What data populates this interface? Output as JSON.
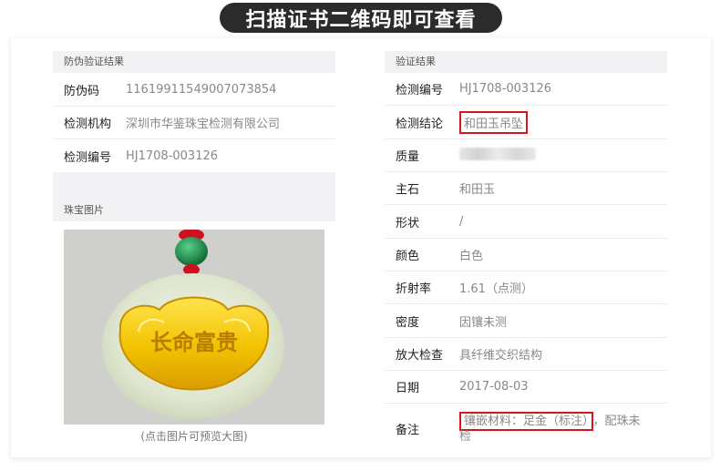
{
  "banner": {
    "title": "扫描证书二维码即可查看"
  },
  "left": {
    "section_title": "防伪验证结果",
    "rows": [
      {
        "label": "防伪码",
        "value": "11619911549007073854"
      },
      {
        "label": "检测机构",
        "value": "深圳市华鉴珠宝检测有限公司"
      },
      {
        "label": "检测编号",
        "value": "HJ1708-003126"
      }
    ],
    "image_section_title": "珠宝图片",
    "image_caption": "(点击图片可预览大图)",
    "image_inscription": "长命富贵"
  },
  "right": {
    "section_title": "验证结果",
    "rows": [
      {
        "label": "检测编号",
        "value": "HJ1708-003126"
      },
      {
        "label": "检测结论",
        "value": "和田玉吊坠"
      },
      {
        "label": "质量",
        "value": ""
      },
      {
        "label": "主石",
        "value": "和田玉"
      },
      {
        "label": "形状",
        "value": "/"
      },
      {
        "label": "颜色",
        "value": "白色"
      },
      {
        "label": "折射率",
        "value": "1.61（点测）"
      },
      {
        "label": "密度",
        "value": "因镶未测"
      },
      {
        "label": "放大检查",
        "value": "具纤维交织结构"
      },
      {
        "label": "日期",
        "value": "2017-08-03"
      },
      {
        "label": "备注",
        "value_highlight": "镶嵌材料：足金（标注）",
        "value_rest_1": "，配珠未",
        "value_rest_2": "检"
      }
    ]
  },
  "colors": {
    "highlight": "#d8141c",
    "banner": "#2b2b2b",
    "gold": "#e9b500",
    "jade": "#dfe6cf"
  }
}
